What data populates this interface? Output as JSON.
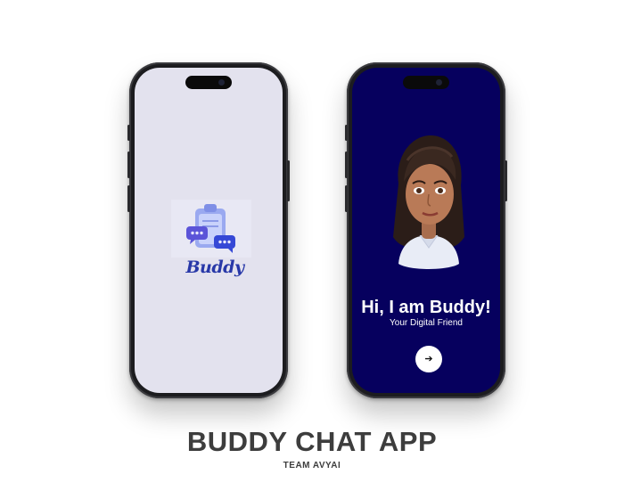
{
  "splash": {
    "logo_text": "Buddy"
  },
  "welcome": {
    "greeting": "Hi, I am Buddy!",
    "subtitle": "Your Digital Friend",
    "next_icon": "arrow-right-icon"
  },
  "caption": {
    "title": "BUDDY CHAT APP",
    "team": "TEAM AVYAI"
  },
  "colors": {
    "splash_background": "#e3e2ee",
    "welcome_background": "#06005e",
    "logo_blue": "#2838a8",
    "caption_text": "#3d3d3d"
  }
}
